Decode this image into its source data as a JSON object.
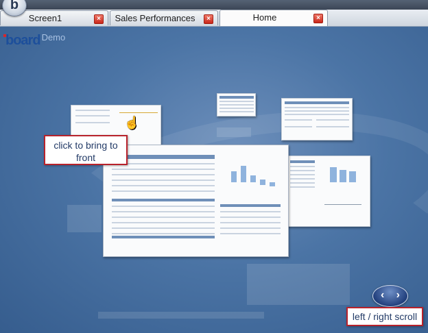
{
  "app": {
    "orb_letter": "b"
  },
  "tabs": [
    {
      "label": "Screen1",
      "active": false
    },
    {
      "label": "Sales Performances",
      "active": false
    },
    {
      "label": "Home",
      "active": true
    }
  ],
  "tab_close_glyph": "×",
  "logo": {
    "brand": "board",
    "suffix": "Demo"
  },
  "callouts": {
    "bring_to_front": "click to bring to front",
    "scroll": "left / right scroll"
  },
  "nav": {
    "left_glyph": "‹",
    "right_glyph": "›"
  },
  "icons": {
    "cursor": "hand-pointer-icon",
    "scroll": "left-right-arrows-icon"
  },
  "colors": {
    "accent_red": "#b8222b",
    "stage_blue": "#4b74a5",
    "brand_blue": "#1d4f9b"
  }
}
